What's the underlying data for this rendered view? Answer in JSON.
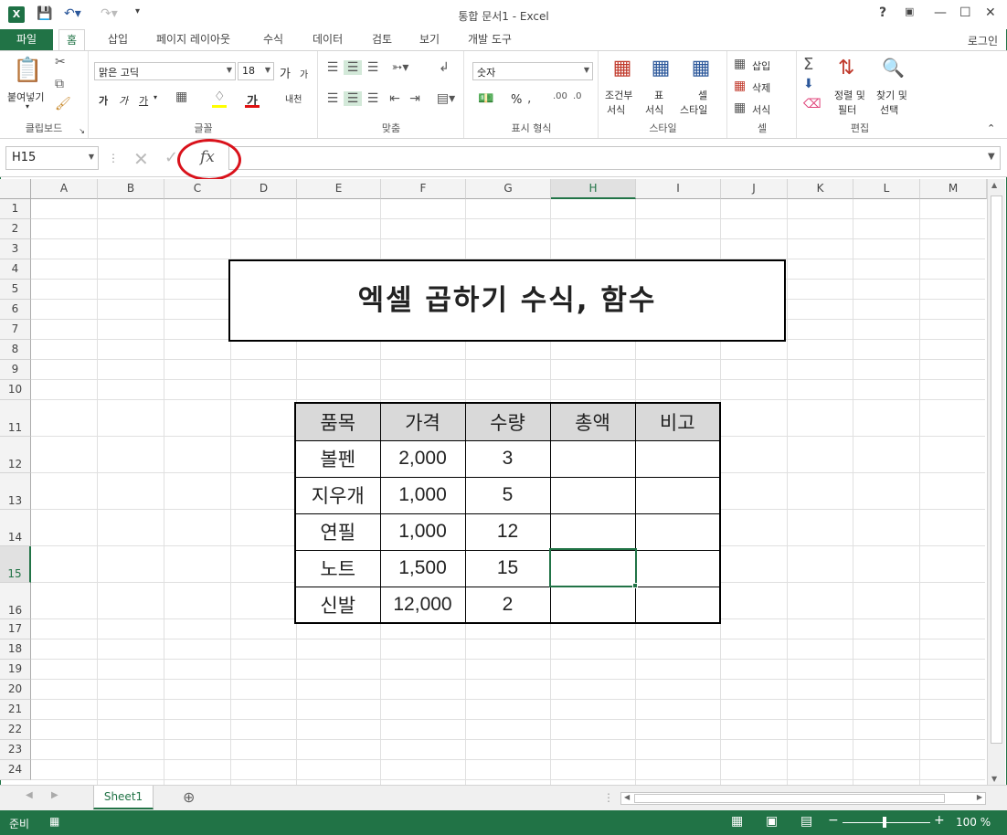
{
  "window": {
    "title": "통합 문서1 - Excel",
    "help": "?",
    "login": "로그인"
  },
  "tabs": [
    "파일",
    "홈",
    "삽입",
    "페이지 레이아웃",
    "수식",
    "데이터",
    "검토",
    "보기",
    "개발 도구"
  ],
  "ribbon": {
    "clipboard": {
      "paste": "붙여넣기",
      "label": "클립보드"
    },
    "font": {
      "name": "맑은 고딕",
      "size": "18",
      "grow": "가",
      "shrink": "가",
      "bold": "가",
      "italic": "가",
      "underline": "가",
      "color_char": "가",
      "wrap": "내천",
      "label": "글꼴"
    },
    "align": {
      "label": "맞춤"
    },
    "number": {
      "format": "숫자",
      "percent": "%",
      "label": "표시 형식"
    },
    "styles": {
      "cond1": "조건부",
      "cond2": "서식",
      "table1": "표",
      "table2": "서식",
      "cell1": "셀",
      "cell2": "스타일",
      "label": "스타일"
    },
    "cells": {
      "insert": "삽입",
      "delete": "삭제",
      "format": "서식",
      "label": "셀"
    },
    "edit": {
      "sort1": "정렬 및",
      "sort2": "필터",
      "find1": "찾기 및",
      "find2": "선택",
      "label": "편집"
    }
  },
  "formula_bar": {
    "name_box": "H15",
    "cancel": "✕",
    "enter": "✓",
    "fx": "fx",
    "value": ""
  },
  "columns": [
    "A",
    "B",
    "C",
    "D",
    "E",
    "F",
    "G",
    "H",
    "I",
    "J",
    "K",
    "L",
    "M"
  ],
  "rows": [
    "1",
    "2",
    "3",
    "4",
    "5",
    "6",
    "7",
    "8",
    "9",
    "10",
    "11",
    "12",
    "13",
    "14",
    "15",
    "16",
    "17",
    "18",
    "19",
    "20",
    "21",
    "22",
    "23",
    "24"
  ],
  "selected_cell": "H15",
  "sheet_title": "엑셀 곱하기 수식, 함수",
  "table": {
    "headers": [
      "품목",
      "가격",
      "수량",
      "총액",
      "비고"
    ],
    "rows": [
      [
        "볼펜",
        "2,000",
        "3",
        "",
        ""
      ],
      [
        "지우개",
        "1,000",
        "5",
        "",
        ""
      ],
      [
        "연필",
        "1,000",
        "12",
        "",
        ""
      ],
      [
        "노트",
        "1,500",
        "15",
        "",
        ""
      ],
      [
        "신발",
        "12,000",
        "2",
        "",
        ""
      ]
    ]
  },
  "sheet_tabs": [
    "Sheet1"
  ],
  "status": {
    "ready": "준비",
    "zoom": "100 %"
  },
  "colors": {
    "accent": "#217346",
    "highlight_circle": "#d9121b",
    "header_fill": "#d9d9d9"
  }
}
